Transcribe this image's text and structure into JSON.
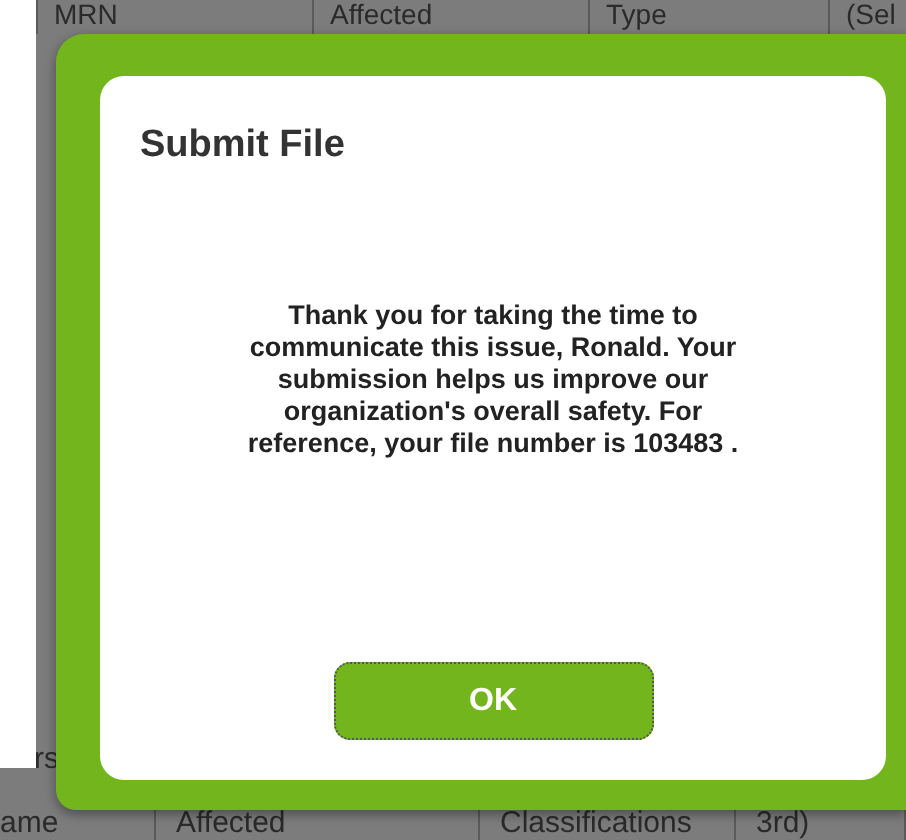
{
  "background_table": {
    "header": [
      "MRN",
      "Affected",
      "Type",
      "(Sel"
    ],
    "side_label": "rs",
    "footer": [
      "ame",
      "Affected",
      "Classifications",
      "3rd)"
    ]
  },
  "dialog": {
    "title": "Submit File",
    "message": "Thank you for taking the time to communicate this issue, Ronald. Your submission helps us improve our organization's overall safety. For reference, your file number is 103483  .",
    "button": "OK"
  }
}
